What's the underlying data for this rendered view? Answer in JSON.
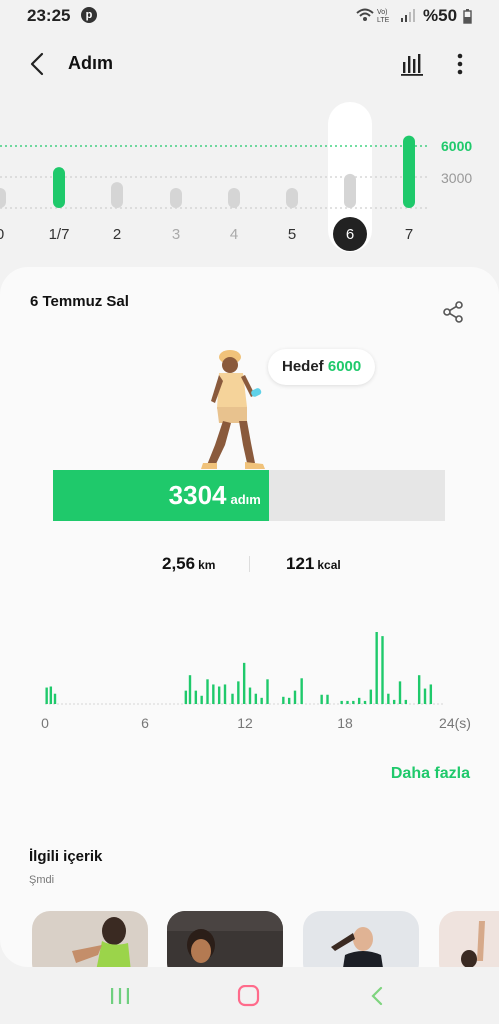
{
  "status_bar": {
    "time": "23:25",
    "battery": "%50"
  },
  "header": {
    "title": "Adım"
  },
  "weekly_chart": {
    "goal_tick": "6000",
    "mid_tick": "3000",
    "days": [
      {
        "label": "0",
        "steps": 1700
      },
      {
        "label": "1/7",
        "steps": 3950
      },
      {
        "label": "2",
        "steps": 2500
      },
      {
        "label": "3",
        "steps": 1600
      },
      {
        "label": "4",
        "steps": 1600
      },
      {
        "label": "5",
        "steps": 1700
      },
      {
        "label": "6",
        "steps": 3304
      },
      {
        "label": "7",
        "steps": 7000
      }
    ],
    "selected_index": 6,
    "goal": 6000,
    "colors": {
      "goal_met": "#1fc96b",
      "below_goal": "#d5d5d5",
      "selected": "#222222"
    }
  },
  "day": {
    "date": "6 Temmuz Sal",
    "goal_label": "Hedef",
    "goal_value": "6000",
    "steps": "3304",
    "steps_unit": "adım",
    "progress_fraction": 0.5507,
    "distance": "2,56",
    "distance_unit": "km",
    "calories": "121",
    "calories_unit": "kcal"
  },
  "hourly": {
    "x_labels": [
      "0",
      "6",
      "12",
      "18",
      "24(s)"
    ],
    "values": [
      [
        0.1,
        16
      ],
      [
        0.35,
        17
      ],
      [
        0.6,
        10
      ],
      [
        8.45,
        13
      ],
      [
        8.7,
        28
      ],
      [
        9.05,
        13
      ],
      [
        9.4,
        8
      ],
      [
        9.75,
        24
      ],
      [
        10.1,
        19
      ],
      [
        10.45,
        17
      ],
      [
        10.8,
        19
      ],
      [
        11.25,
        10
      ],
      [
        11.6,
        22
      ],
      [
        11.95,
        40
      ],
      [
        12.3,
        16
      ],
      [
        12.65,
        10
      ],
      [
        13.0,
        6
      ],
      [
        13.35,
        24
      ],
      [
        14.3,
        7
      ],
      [
        14.65,
        6
      ],
      [
        15.0,
        13
      ],
      [
        15.4,
        25
      ],
      [
        16.6,
        9
      ],
      [
        16.95,
        9
      ],
      [
        17.8,
        3
      ],
      [
        18.15,
        3
      ],
      [
        18.5,
        3
      ],
      [
        18.85,
        6
      ],
      [
        19.2,
        3
      ],
      [
        19.55,
        14
      ],
      [
        19.9,
        70
      ],
      [
        20.25,
        66
      ],
      [
        20.6,
        10
      ],
      [
        20.95,
        4
      ],
      [
        21.3,
        22
      ],
      [
        21.65,
        4
      ],
      [
        22.45,
        28
      ],
      [
        22.8,
        15
      ],
      [
        23.15,
        19
      ]
    ],
    "bar_color": "#1fc96b"
  },
  "more_link": "Daha fazla",
  "related": {
    "title": "İlgili içerik",
    "subtitle": "Şmdi"
  }
}
